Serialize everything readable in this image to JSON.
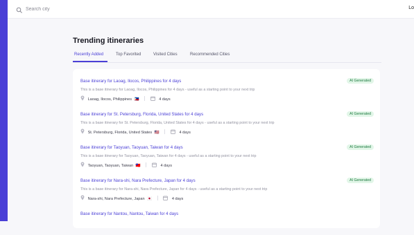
{
  "search": {
    "placeholder": "Search city"
  },
  "header": {
    "login_label": "Lo"
  },
  "main": {
    "title": "Trending itineraries",
    "tabs": [
      {
        "label": "Recently Added",
        "active": true
      },
      {
        "label": "Top Favorited",
        "active": false
      },
      {
        "label": "Visited Cities",
        "active": false
      },
      {
        "label": "Recommended Cities",
        "active": false
      }
    ]
  },
  "itineraries": [
    {
      "title": "Base itinerary for Laoag, Ilocos, Philippines for 4 days",
      "description": "This is a base itinerary for Laoag, Ilocos, Philippines for 4 days - useful as a starting point to your next trip",
      "location": "Laoag, Ilocos, Philippines",
      "flag": "🇵🇭",
      "duration": "4 days",
      "badge": "AI Generated"
    },
    {
      "title": "Base itinerary for St. Petersburg, Florida, United States for 4 days",
      "description": "This is a base itinerary for St. Petersburg, Florida, United States for 4 days - useful as a starting point to your next trip",
      "location": "St. Petersburg, Florida, United States",
      "flag": "🇺🇸",
      "duration": "4 days",
      "badge": "AI Generated"
    },
    {
      "title": "Base itinerary for Taoyuan, Taoyuan, Taiwan for 4 days",
      "description": "This is a base itinerary for Taoyuan, Taoyuan, Taiwan for 4 days - useful as a starting point to your next trip",
      "location": "Taoyuan, Taoyuan, Taiwan",
      "flag": "🇹🇼",
      "duration": "4 days",
      "badge": "AI Generated"
    },
    {
      "title": "Base itinerary for Nara-shi, Nara Prefecture, Japan for 4 days",
      "description": "This is a base itinerary for Nara-shi, Nara Prefecture, Japan for 4 days - useful as a starting point to your next trip",
      "location": "Nara-shi, Nara Prefecture, Japan",
      "flag": "🇯🇵",
      "duration": "4 days",
      "badge": "AI Generated"
    },
    {
      "title": "Base itinerary for Nantou, Nantou, Taiwan for 4 days",
      "description": "",
      "location": "",
      "flag": "",
      "duration": "",
      "badge": ""
    }
  ],
  "colors": {
    "accent": "#4a3fd6",
    "badge_bg": "#e2f6e8",
    "badge_text": "#1d7a3f",
    "page_bg": "#f7f7fa"
  },
  "icons": {
    "search": "search-icon",
    "location": "location-pin-icon",
    "calendar": "calendar-icon"
  }
}
